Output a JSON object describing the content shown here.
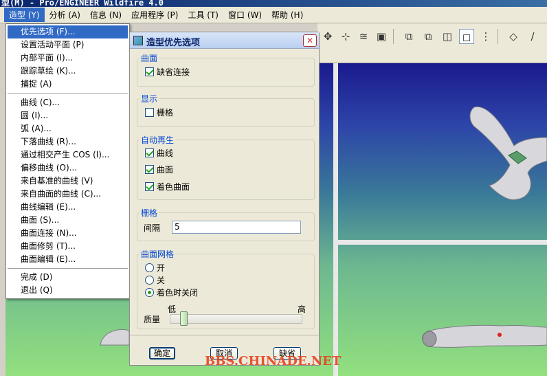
{
  "titlebar": {
    "text": "型(M) - Pro/ENGINEER Wildfire 4.0"
  },
  "menubar": {
    "items": [
      {
        "label": "造型 (Y)"
      },
      {
        "label": "分析 (A)"
      },
      {
        "label": "信息 (N)"
      },
      {
        "label": "应用程序 (P)"
      },
      {
        "label": "工具 (T)"
      },
      {
        "label": "窗口 (W)"
      },
      {
        "label": "帮助 (H)"
      }
    ]
  },
  "toolbar": {
    "icons": [
      "move-icon",
      "datum-icon",
      "layers-icon",
      "save-view-icon",
      "box-view-icon",
      "box-view-2-icon",
      "box-view-3-icon",
      "box-view-4-icon",
      "tree-icon",
      "style-icon",
      "curve-tool-icon"
    ]
  },
  "dropdown": {
    "items": [
      {
        "label": "优先选项 (F)..."
      },
      {
        "label": "设置活动平面 (P)"
      },
      {
        "label": "内部平面 (I)..."
      },
      {
        "label": "跟踪草绘 (K)..."
      },
      {
        "label": "捕捉 (A)"
      },
      {
        "label": "曲线 (C)..."
      },
      {
        "label": "圆 (I)..."
      },
      {
        "label": "弧 (A)..."
      },
      {
        "label": "下落曲线 (R)..."
      },
      {
        "label": "通过相交产生 COS (I)..."
      },
      {
        "label": "偏移曲线 (O)..."
      },
      {
        "label": "来自基准的曲线 (V)"
      },
      {
        "label": "来自曲面的曲线 (C)..."
      },
      {
        "label": "曲线编辑 (E)..."
      },
      {
        "label": "曲面 (S)..."
      },
      {
        "label": "曲面连接 (N)..."
      },
      {
        "label": "曲面修剪 (T)..."
      },
      {
        "label": "曲面编辑 (E)..."
      },
      {
        "label": "完成 (D)"
      },
      {
        "label": "退出 (Q)"
      }
    ]
  },
  "dialog": {
    "title": "造型优先选项",
    "close": "✕",
    "surface_group": {
      "title": "曲面",
      "default_connect": "缺省连接"
    },
    "display_group": {
      "title": "显示",
      "grid": "栅格"
    },
    "regen_group": {
      "title": "自动再生",
      "curve": "曲线",
      "surface": "曲面",
      "shaded": "着色曲面"
    },
    "grid_group": {
      "title": "栅格",
      "spacing_label": "间隔",
      "spacing_value": "5"
    },
    "mesh_group": {
      "title": "曲面网格",
      "on": "开",
      "off": "关",
      "off_when_shaded": "着色时关闭",
      "low": "低",
      "high": "高",
      "quality_label": "质量",
      "quality_level": 0.08
    },
    "ok": "确定",
    "cancel": "取消",
    "default": "缺省"
  },
  "watermark": "BBS.CHINADE.NET"
}
